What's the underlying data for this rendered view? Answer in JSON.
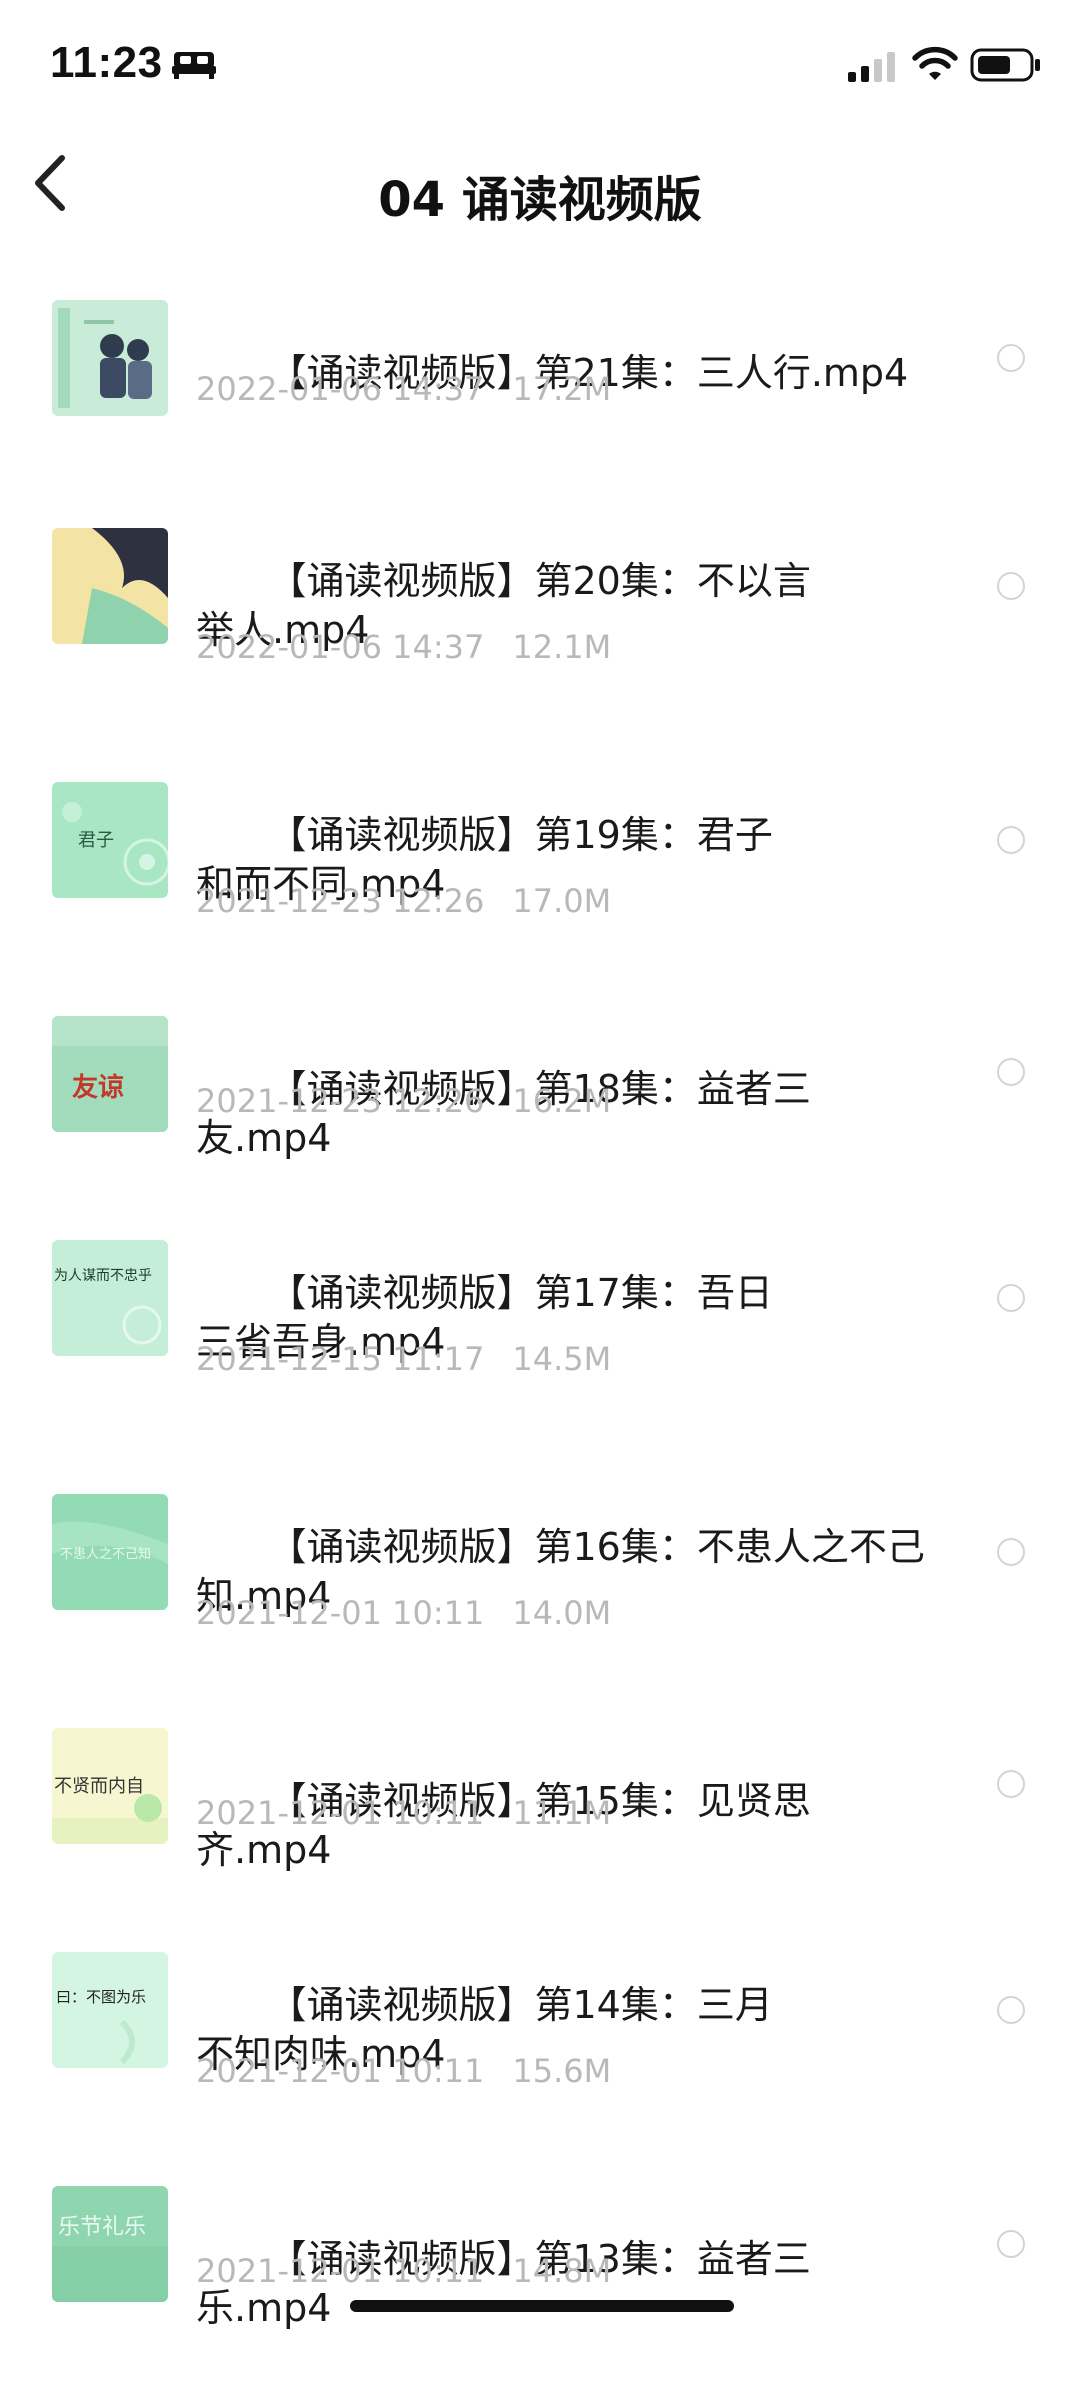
{
  "status_bar": {
    "time": "11:23",
    "icons": [
      "bed-icon",
      "signal-icon",
      "wifi-icon",
      "battery-icon"
    ]
  },
  "nav": {
    "back_icon": "chevron-left-icon",
    "title": "04 诵读视频版"
  },
  "colors": {
    "thumb_green": "#a8e6c4",
    "meta_gray": "#b8b8b8",
    "radio_border": "#d4d4d4"
  },
  "files": [
    {
      "line1": "【诵读视频版】第21集：三人行.mp4",
      "line2": "",
      "date": "2022-01-06 14:37",
      "size": "17.2M",
      "selected": false,
      "thumb_text": ""
    },
    {
      "line1": "【诵读视频版】第20集：不以言",
      "line2": "举人.mp4",
      "date": "2022-01-06 14:37",
      "size": "12.1M",
      "selected": false,
      "thumb_text": ""
    },
    {
      "line1": "【诵读视频版】第19集：君子",
      "line2": "和而不同.mp4",
      "date": "2021-12-23 12:26",
      "size": "17.0M",
      "selected": false,
      "thumb_text": "君子"
    },
    {
      "line1": "【诵读视频版】第18集：益者三友.mp4",
      "line2": "",
      "date": "2021-12-23 12:26",
      "size": "16.2M",
      "selected": false,
      "thumb_text": "友谅"
    },
    {
      "line1": "【诵读视频版】第17集：吾日",
      "line2": "三省吾身.mp4",
      "date": "2021-12-15 11:17",
      "size": "14.5M",
      "selected": false,
      "thumb_text": "为人谋而不忠乎"
    },
    {
      "line1": "【诵读视频版】第16集：不患人之不己",
      "line2": "知.mp4",
      "date": "2021-12-01 10:11",
      "size": "14.0M",
      "selected": false,
      "thumb_text": "不患人之不己知"
    },
    {
      "line1": "【诵读视频版】第15集：见贤思齐.mp4",
      "line2": "",
      "date": "2021-12-01 10:11",
      "size": "11.1M",
      "selected": false,
      "thumb_text": "不贤而内自"
    },
    {
      "line1": "【诵读视频版】第14集：三月",
      "line2": "不知肉味.mp4",
      "date": "2021-12-01 10:11",
      "size": "15.6M",
      "selected": false,
      "thumb_text": "曰：不图为乐"
    },
    {
      "line1": "【诵读视频版】第13集：益者三乐.mp4",
      "line2": "",
      "date": "2021-12-01 10:11",
      "size": "14.8M",
      "selected": false,
      "thumb_text": "乐节礼乐"
    }
  ]
}
